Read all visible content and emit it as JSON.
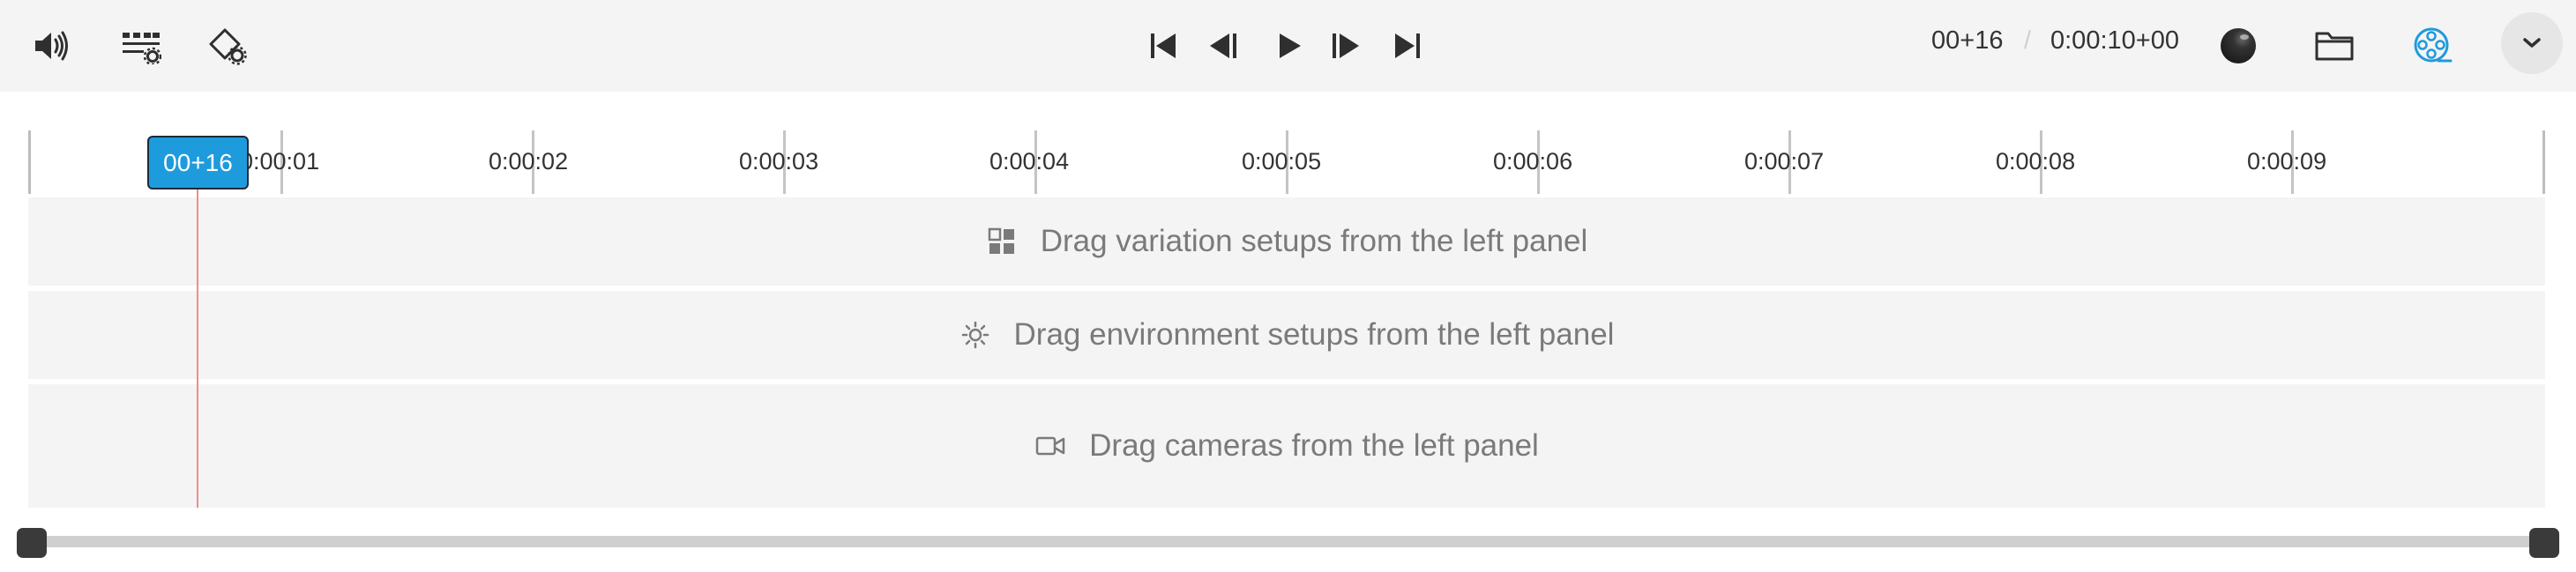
{
  "toolbar": {
    "left_icons": [
      "speaker-icon",
      "track-settings-icon",
      "keyframe-settings-icon"
    ],
    "transport_icons": [
      "skip-to-start-icon",
      "step-back-icon",
      "play-icon",
      "step-forward-icon",
      "skip-to-end-icon"
    ],
    "timecode_current": "00+16",
    "timecode_separator": "/",
    "timecode_total": "0:00:10+00",
    "right_icons": [
      "render-sphere-icon",
      "folder-icon",
      "film-reel-icon",
      "chevron-down-icon"
    ],
    "accent_color": "#1e9bdc"
  },
  "timeline": {
    "playhead_label": "00+16",
    "ticks": [
      "0:00:01",
      "0:00:02",
      "0:00:03",
      "0:00:04",
      "0:00:05",
      "0:00:06",
      "0:00:07",
      "0:00:08",
      "0:00:09"
    ]
  },
  "tracks": {
    "variations": {
      "icon": "variations-grid-icon",
      "label": "Drag variation setups from the left panel"
    },
    "environment": {
      "icon": "sun-icon",
      "label": "Drag environment setups from the left panel"
    },
    "cameras": {
      "icon": "camera-icon",
      "label": "Drag cameras from the left panel"
    }
  }
}
